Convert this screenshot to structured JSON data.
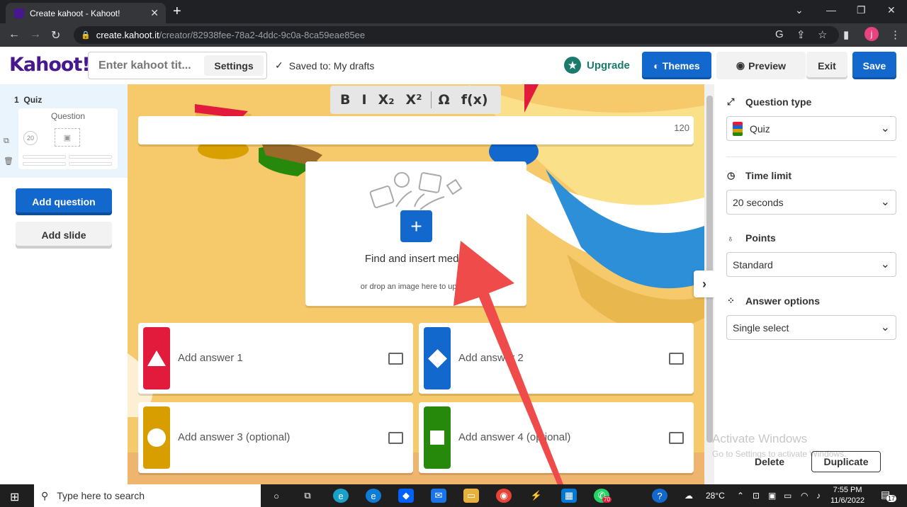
{
  "browser": {
    "tab_title": "Create kahoot - Kahoot!",
    "url_host": "create.kahoot.it",
    "url_path": "/creator/82938fee-78a2-4ddc-9c0a-8ca59eae85ee",
    "avatar_letter": "j"
  },
  "header": {
    "logo": "Kahoot!",
    "title_placeholder": "Enter kahoot tit...",
    "settings_label": "Settings",
    "saved_text": "Saved to: My drafts",
    "upgrade_label": "Upgrade",
    "themes_label": "Themes",
    "preview_label": "Preview",
    "exit_label": "Exit",
    "save_label": "Save"
  },
  "sidebar": {
    "slide_number": "1",
    "slide_type": "Quiz",
    "thumb_label": "Question",
    "thumb_timer": "20",
    "add_question_label": "Add question",
    "add_slide_label": "Add slide"
  },
  "editor": {
    "format_buttons": [
      "B",
      "I",
      "X₂",
      "X²",
      "Ω",
      "f(x)"
    ],
    "char_count": "120",
    "media_title": "Find and insert media",
    "media_drop": "or drop an image here to upload",
    "answers": [
      {
        "label": "Add answer 1",
        "color": "#e21b3c",
        "shape": "triangle"
      },
      {
        "label": "Add answer 2",
        "color": "#1368ce",
        "shape": "diamond"
      },
      {
        "label": "Add answer 3 (optional)",
        "color": "#d89e00",
        "shape": "circle"
      },
      {
        "label": "Add answer 4 (optional)",
        "color": "#26890c",
        "shape": "square"
      }
    ]
  },
  "panel": {
    "question_type_label": "Question type",
    "question_type_value": "Quiz",
    "time_limit_label": "Time limit",
    "time_limit_value": "20 seconds",
    "points_label": "Points",
    "points_value": "Standard",
    "answer_options_label": "Answer options",
    "answer_options_value": "Single select",
    "delete_label": "Delete",
    "duplicate_label": "Duplicate"
  },
  "watermark": {
    "line1": "Activate Windows",
    "line2": "Go to Settings to activate Windows."
  },
  "taskbar": {
    "search_placeholder": "Type here to search",
    "temperature": "28°C",
    "time": "7:55 PM",
    "date": "11/6/2022",
    "whatsapp_badge": "70",
    "notifications": "17"
  },
  "colors": {
    "brand_purple": "#46178f",
    "primary_blue": "#1368ce",
    "canvas_bg": "#f6c96b",
    "annotation_arrow": "#ef4b4b"
  }
}
